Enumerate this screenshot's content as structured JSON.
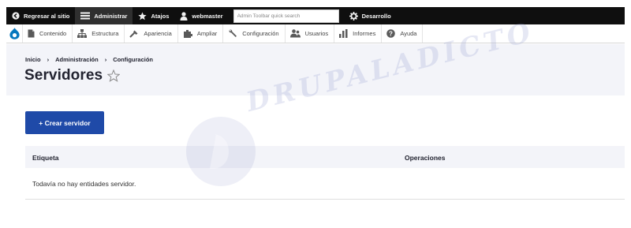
{
  "toolbar": {
    "back_label": "Regresar al sitio",
    "admin_label": "Administrar",
    "shortcuts_label": "Atajos",
    "user_label": "webmaster",
    "search_placeholder": "Admin Toolbar quick search",
    "dev_label": "Desarrollo"
  },
  "menu": {
    "items": [
      {
        "label": "Contenido",
        "icon": "content-icon"
      },
      {
        "label": "Estructura",
        "icon": "structure-icon"
      },
      {
        "label": "Apariencia",
        "icon": "appearance-icon"
      },
      {
        "label": "Ampliar",
        "icon": "extend-icon"
      },
      {
        "label": "Configuración",
        "icon": "wrench-icon"
      },
      {
        "label": "Usuarios",
        "icon": "users-icon"
      },
      {
        "label": "Informes",
        "icon": "reports-icon"
      },
      {
        "label": "Ayuda",
        "icon": "help-icon"
      }
    ]
  },
  "breadcrumb": {
    "items": [
      "Inicio",
      "Administración",
      "Configuración"
    ],
    "separator": "›"
  },
  "page": {
    "title": "Servidores"
  },
  "actions": {
    "add_label": "+ Crear servidor"
  },
  "table": {
    "columns": [
      "Etiqueta",
      "Operaciones"
    ],
    "empty_text": "Todavía no hay entidades servidor."
  },
  "watermark": {
    "text": "DRUPALADICTO"
  },
  "colors": {
    "toolbar_bg": "#0f0f0f",
    "primary_button": "#1f4aa8",
    "header_bg": "#f3f4f9",
    "drupal_blue": "#0678be"
  }
}
